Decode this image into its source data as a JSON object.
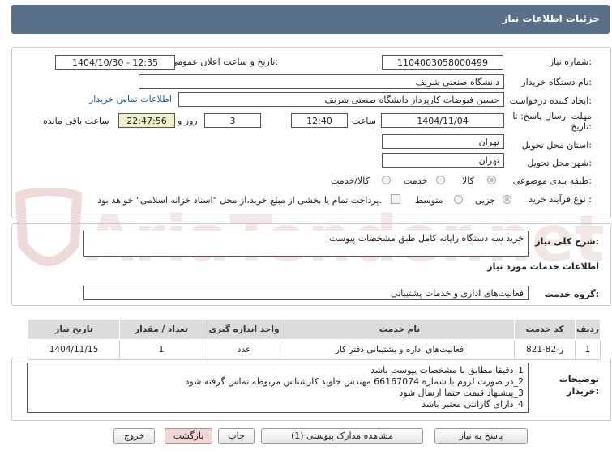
{
  "header": {
    "title": "جزئیات اطلاعات نیاز"
  },
  "fields": {
    "need_number_label": "شماره نیاز:",
    "need_number": "1104003058000499",
    "announce_label": "تاریخ و ساعت اعلان عمومی:",
    "announce_value": "1404/10/30 - 12:35",
    "buyer_org_label": "نام دستگاه خریدار:",
    "buyer_org": "دانشگاه صنعتی شریف",
    "creator_label": "ایجاد کننده درخواست:",
    "creator": "حسین فیوضات کارپرداز دانشگاه صنعتی شریف",
    "contact_link": "اطلاعات تماس خریدار",
    "deadline_label_1": "مهلت ارسال پاسخ: تا",
    "deadline_label_2": "تاریخ:",
    "deadline_date": "1404/11/04",
    "time_label": "ساعت",
    "deadline_time": "12:40",
    "days_value": "3",
    "days_label": "روز و",
    "remaining_time": "22:47:56",
    "remaining_label": "ساعت باقی مانده",
    "province_label": "استان محل تحویل:",
    "province": "تهران",
    "city_label": "شهر محل تحویل:",
    "city": "تهران",
    "category_label": "طبقه بندی موضوعی:",
    "category_options": [
      "کالا",
      "خدمت",
      "کالا/خدمت"
    ],
    "process_label": "نوع فرآیند خرید :",
    "process_options": [
      "جزیی",
      "متوسط"
    ],
    "payment_note": "پرداخت تمام یا بخشی از مبلغ خرید،از محل \"اسناد خزانه اسلامی\" خواهد بود."
  },
  "summary": {
    "label": "شرح کلی نیاز:",
    "value": "خرید سه دستگاه رایانه کامل طبق مشخصات پیوست"
  },
  "services": {
    "section_title": "اطلاعات خدمات مورد نیاز",
    "group_label": "گروه خدمت:",
    "group_value": "فعالیت‌های اداری و خدمات پشتیبانی",
    "columns": [
      "ردیف",
      "کد خدمت",
      "نام خدمت",
      "واحد اندازه گیری",
      "تعداد / مقدار",
      "تاریخ نیاز"
    ],
    "rows": [
      {
        "row": "1",
        "code": "ز-82-821",
        "name": "فعالیت‌های اداره و پشتیبانی دفتر کار",
        "unit": "عدد",
        "qty": "1",
        "date": "1404/11/15"
      }
    ]
  },
  "notes": {
    "label_1": "توضیحات",
    "label_2": "خریدار:",
    "lines": [
      "1_دقیقا مطابق با مشخصات پیوست باشد",
      "2_در صورت لزوم با شماره 66167074 مهندس جاوید کارشناس مربوطه تماس گرفته شود",
      "3_پیشنهاد قیمت حتما ارسال شود",
      "4_دارای گارانتی معتبر باشد"
    ]
  },
  "buttons": {
    "reply": "پاسخ به نیاز",
    "attachments": "مشاهده مدارک پیوستی (1)",
    "print": "چاپ",
    "back": "بازگشت",
    "exit": "خروج"
  },
  "watermark": {
    "text": "AriaTender.net"
  },
  "colors": {
    "header_bg": "#5a6f89",
    "remaining_bg": "#f2f0c8",
    "back_bg": "#f3d6d6",
    "watermark": "#e6c9c9"
  }
}
